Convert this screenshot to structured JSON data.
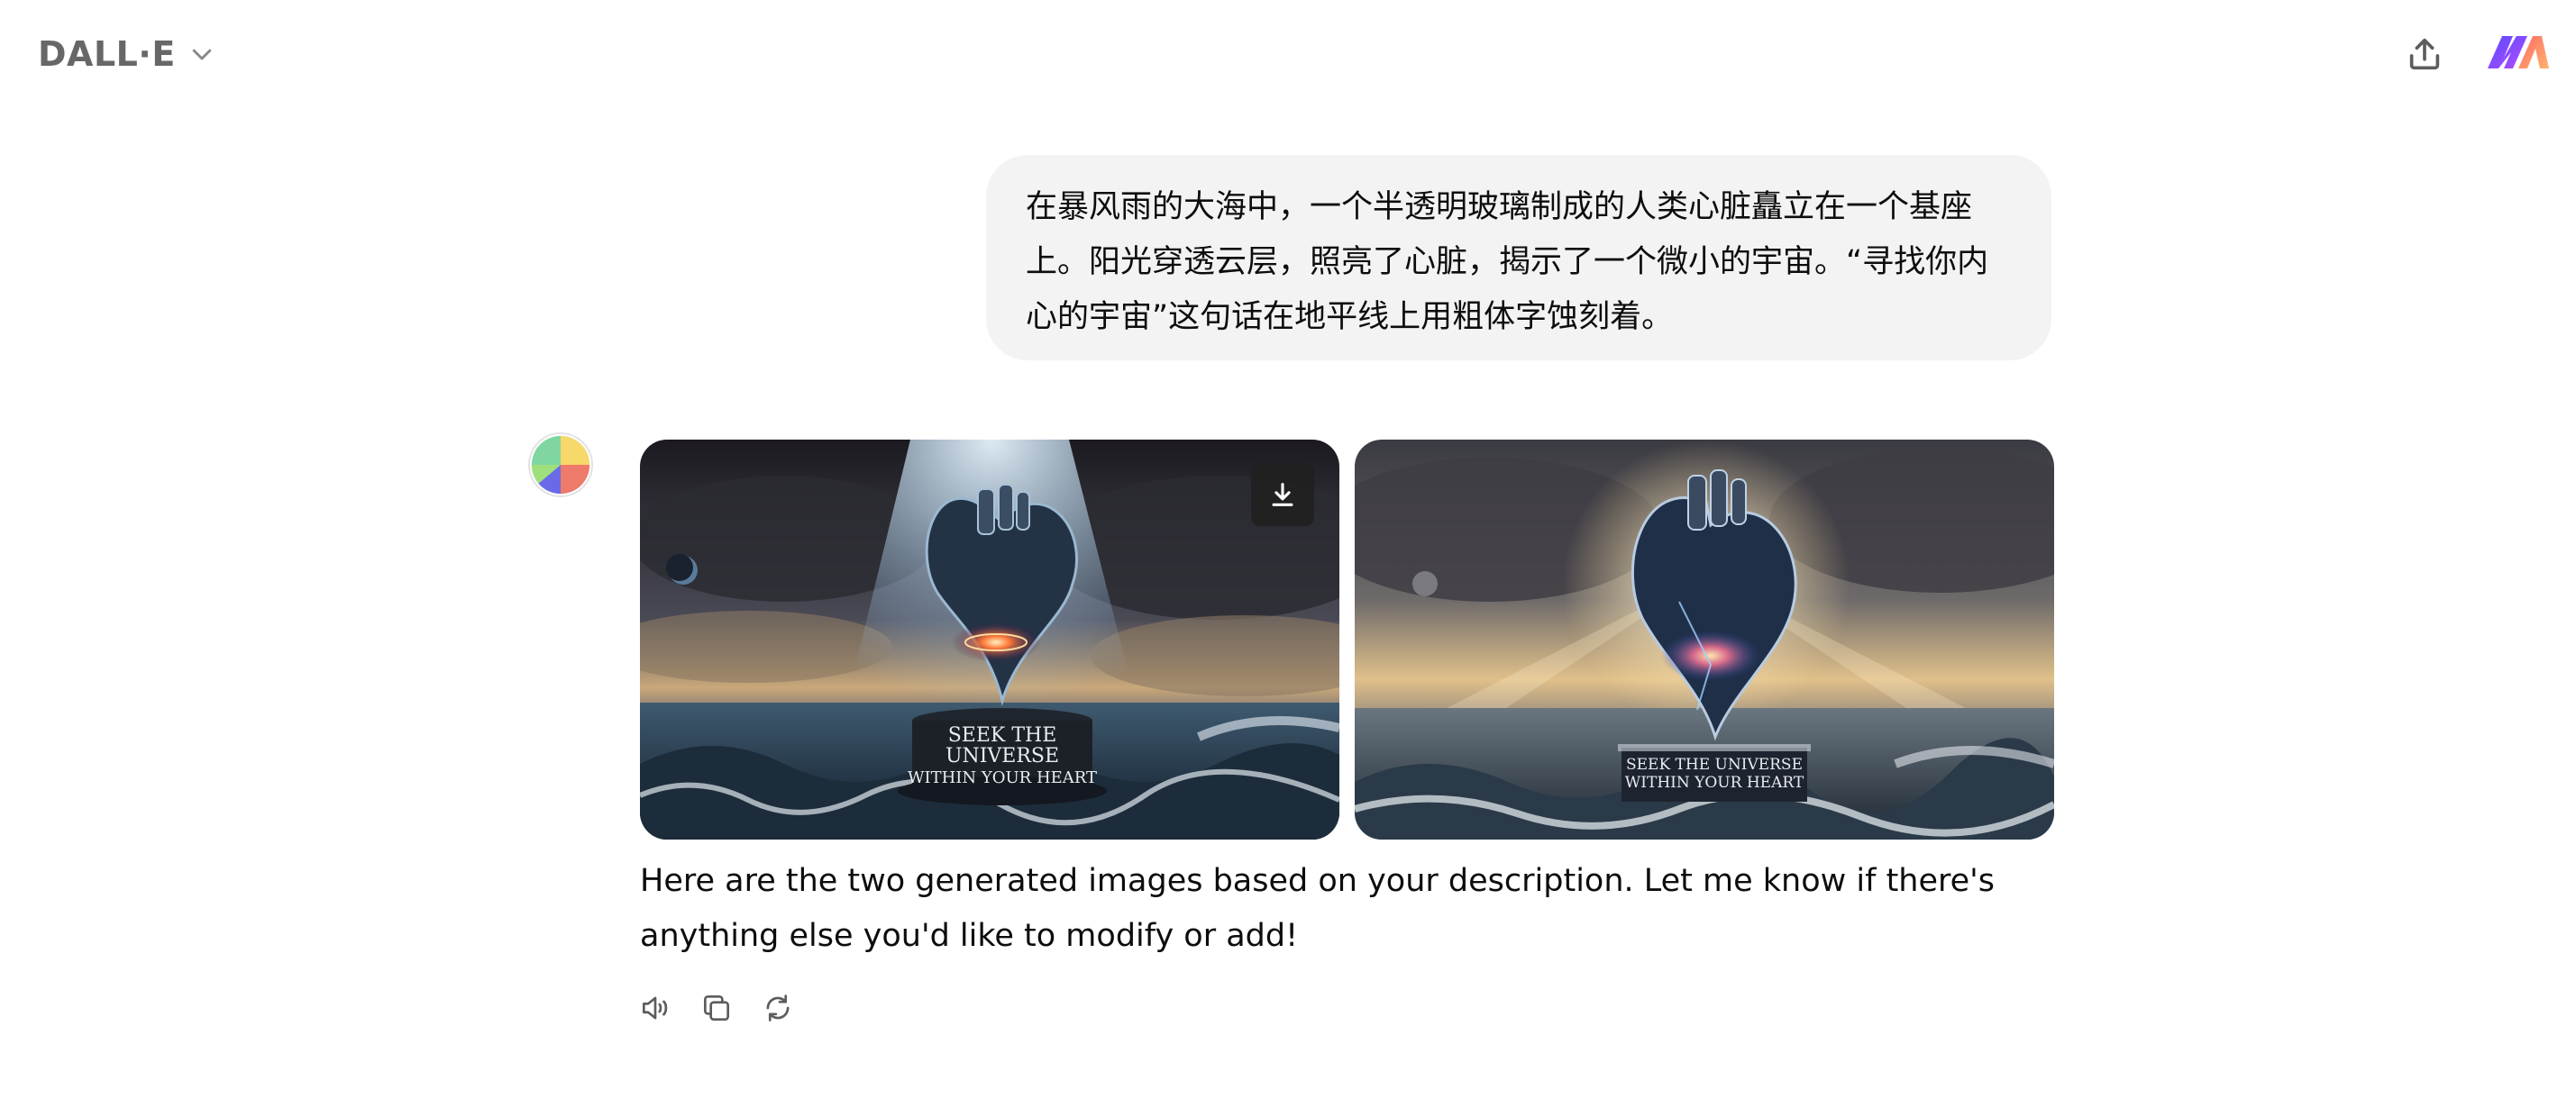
{
  "header": {
    "model_label": "DALL·E",
    "chevron_icon": "chevron-down-icon",
    "share_icon": "share-upload-icon"
  },
  "user_message": {
    "text": "在暴风雨的大海中，一个半透明玻璃制成的人类心脏矗立在一个基座\n上。阳光穿透云层，照亮了心脏，揭示了一个微小的宇宙。“寻找你内\n心的宇宙”这句话在地平线上用粗体字蚀刻着。"
  },
  "assistant": {
    "images": [
      {
        "pedestal_text": [
          "SEEK THE",
          "UNIVERSE",
          "WITHIN YOUR HEART"
        ]
      },
      {
        "pedestal_text": [
          "SEEK THE UNIVERSE",
          "WITHIN YOUR HEART"
        ]
      }
    ],
    "response_text": "Here are the two generated images based on your description. Let me know if there's anything else you'd like to modify or add!",
    "actions": [
      "read-aloud-icon",
      "copy-icon",
      "regenerate-icon"
    ]
  },
  "colors": {
    "bubble_bg": "#f3f3f3",
    "muted_text": "#676767",
    "download_bg": "#202020"
  }
}
